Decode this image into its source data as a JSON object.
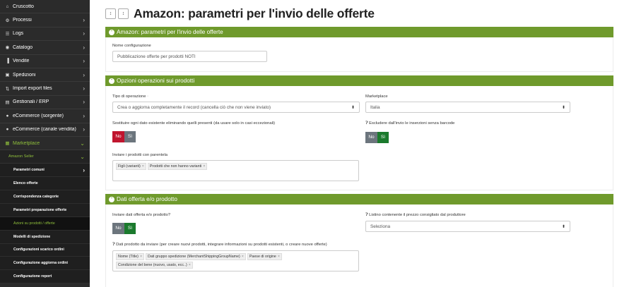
{
  "sidebar": {
    "items": [
      {
        "label": "Cruscotto",
        "icon": "home-icon",
        "glyph": "⌂",
        "chev": ""
      },
      {
        "label": "Processi",
        "icon": "gears-icon",
        "glyph": "⚙",
        "chev": "›"
      },
      {
        "label": "Logs",
        "icon": "list-icon",
        "glyph": "☰",
        "chev": "›"
      },
      {
        "label": "Catalogo",
        "icon": "catalog-icon",
        "glyph": "◉",
        "chev": "›"
      },
      {
        "label": "Vendite",
        "icon": "chart-icon",
        "glyph": "▐",
        "chev": "›"
      },
      {
        "label": "Spedizioni",
        "icon": "truck-icon",
        "glyph": "▣",
        "chev": "›"
      },
      {
        "label": "Import export files",
        "icon": "import-export-icon",
        "glyph": "⇅",
        "chev": "›"
      },
      {
        "label": "Gestionali / ERP",
        "icon": "erp-icon",
        "glyph": "▤",
        "chev": "›"
      },
      {
        "label": "eCommerce (sorgente)",
        "icon": "cart-icon",
        "glyph": "●",
        "chev": "›"
      },
      {
        "label": "eCommerce (canale vendita)",
        "icon": "cart-icon",
        "glyph": "●",
        "chev": "›"
      },
      {
        "label": "Marketplace",
        "icon": "store-icon",
        "glyph": "▦",
        "chev": "⌄"
      }
    ],
    "sub": {
      "label": "Amazon Seller",
      "chev": "⌄"
    },
    "subsub": [
      {
        "label": "Parametri comuni",
        "chev": "›"
      },
      {
        "label": "Elenco offerte",
        "chev": ""
      },
      {
        "label": "Corrispondenza categorie",
        "chev": ""
      },
      {
        "label": "Parametri preparazione offerte",
        "chev": ""
      },
      {
        "label": "Azioni su prodotti / offerte",
        "chev": ""
      },
      {
        "label": "Modelli di spedizione",
        "chev": ""
      },
      {
        "label": "Configurazioni scarico ordini",
        "chev": ""
      },
      {
        "label": "Configurazione aggiorna ordini",
        "chev": ""
      },
      {
        "label": "Configurazione report",
        "chev": ""
      }
    ]
  },
  "header": {
    "title": "Amazon: parametri per l'invio delle offerte",
    "btn1": "↕",
    "btn2": "↕"
  },
  "panel1": {
    "title": "Amazon: parametri per l'invio delle offerte",
    "name_label": "Nome configurazione",
    "name_value": "Pubblicazione offerte per prodotti NOTI"
  },
  "panel2": {
    "title": "Opzioni operazioni sui prodotti",
    "op_label": "Tipo di operazione",
    "op_value": "Crea o aggiorna completamente il record (cancella ciò che non viene inviato)",
    "mkt_label": "Marketplace",
    "mkt_value": "Italia",
    "replace_label": "Sostituire ogni dato esistente eliminando quelli presenti (da usare solo in casi eccezionali)",
    "exclude_label": "Escludere dall'invio le inserzioni senza barcode",
    "no": "No",
    "si": "Sì",
    "parent_label": "Inviare i prodotti con parentela",
    "parent_tags": [
      "Figli (varianti)",
      "Prodotti che non hanno varianti"
    ]
  },
  "panel3": {
    "title": "Dati offerta e/o prodotto",
    "send_label": "Inviare dati offerta e/o prodotto?",
    "list_label": "Listino contenente il prezzo consigliato dal produttore",
    "list_value": "Seleziona",
    "data_label": "Dati prodotto da inviare (per creare nuovi prodotti, integrare informazioni su prodotti esistenti, o creare nuove offerte)",
    "data_tags": [
      "Nome (Title)",
      "Dati gruppo spedizione (MerchantShippingGroupName)",
      "Paese di origine",
      "Condizione del bene (nuovo, usato, ecc..)"
    ]
  },
  "colors": {
    "accent": "#6f9a2c",
    "sidebar": "#2b2b2b",
    "no_active": "#c0152e",
    "si_active": "#1b7a2d"
  }
}
